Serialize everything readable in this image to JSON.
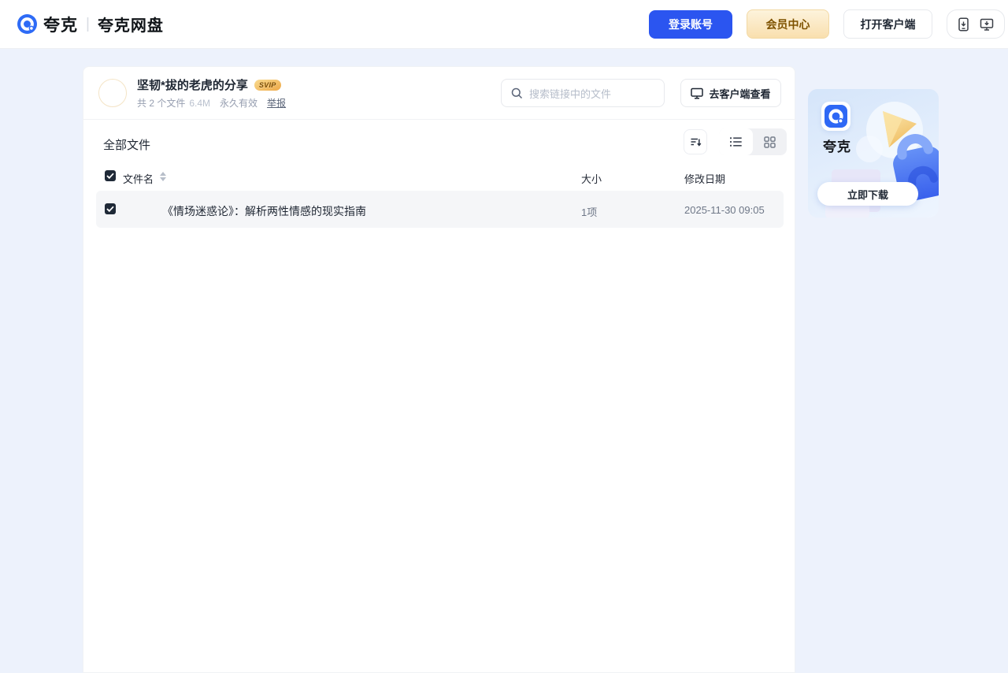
{
  "colors": {
    "accent_blue": "#2B55F0",
    "vip_gold_text": "#7E5200",
    "checkbox_dark": "#1F2937",
    "page_bg": "#EDF2FC"
  },
  "icons": {
    "search": "magnifier",
    "client_view": "monitor",
    "sort": "sort-lines-arrow",
    "view_list": "list-bullets",
    "view_grid": "grid-squares",
    "phone": "phone-download",
    "desktop": "desktop-download",
    "logo": "quark-ring"
  },
  "topbar": {
    "brand": "夸克",
    "separator": "|",
    "product": "夸克网盘",
    "login": "登录账号",
    "vip": "会员中心",
    "open_client": "打开客户端"
  },
  "share": {
    "title": "坚韧*拔的老虎的分享",
    "badge": "SVIP",
    "files_count": "共 2 个文件",
    "total_size": "6.4M",
    "validity": "永久有效",
    "report": "举报",
    "search_placeholder": "搜索链接中的文件",
    "client_view": "去客户端查看"
  },
  "files": {
    "section_title": "全部文件",
    "columns": {
      "name": "文件名",
      "size": "大小",
      "modified": "修改日期"
    },
    "rows": [
      {
        "name": "《情场迷惑论》：解析两性情感的现实指南",
        "size": "1项",
        "modified": "2025-11-30 09:05",
        "checked": true
      }
    ]
  },
  "promo": {
    "app_name": "夸克",
    "cta": "立即下载"
  }
}
